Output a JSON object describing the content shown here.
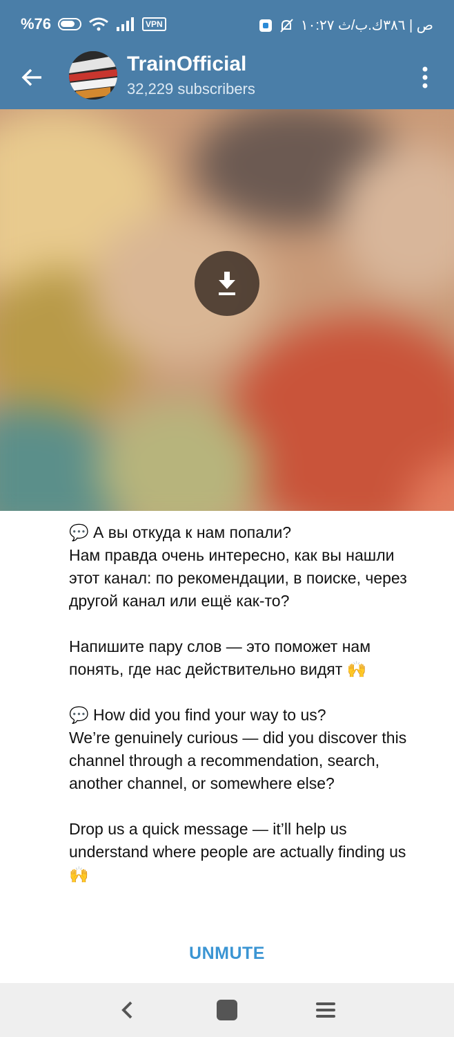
{
  "status_bar": {
    "battery_text": "%76",
    "vpn_label": "VPN",
    "time_text": "۱۰:۲۷ ص | ۳۸٦ك.ب/ث"
  },
  "header": {
    "channel_title": "TrainOfficial",
    "subscribers": "32,229 subscribers"
  },
  "message": {
    "paragraphs": [
      "💬 А вы откуда к нам попали?\nНам правда очень интересно, как вы нашли этот канал: по рекомендации, в поиске, через другой канал или ещё как-то?",
      "Напишите пару слов — это поможет нам понять, где нас действительно видят 🙌",
      "💬 How did you find your way to us?\nWe’re genuinely curious — did you discover this channel through a recommendation, search, another channel, or somewhere else?",
      "Drop us a quick message — it’ll help us understand where people are actually finding us 🙌"
    ]
  },
  "footer": {
    "unmute_label": "UNMUTE"
  },
  "icons": {
    "back": "arrow-left-icon",
    "menu": "more-vertical-icon",
    "download": "download-icon",
    "battery": "battery-icon",
    "wifi": "wifi-icon",
    "signal": "signal-icon",
    "mute": "bell-off-icon"
  },
  "colors": {
    "header_bg": "#4a7ea8",
    "accent": "#3b95d3",
    "navbar_bg": "#efefef"
  }
}
